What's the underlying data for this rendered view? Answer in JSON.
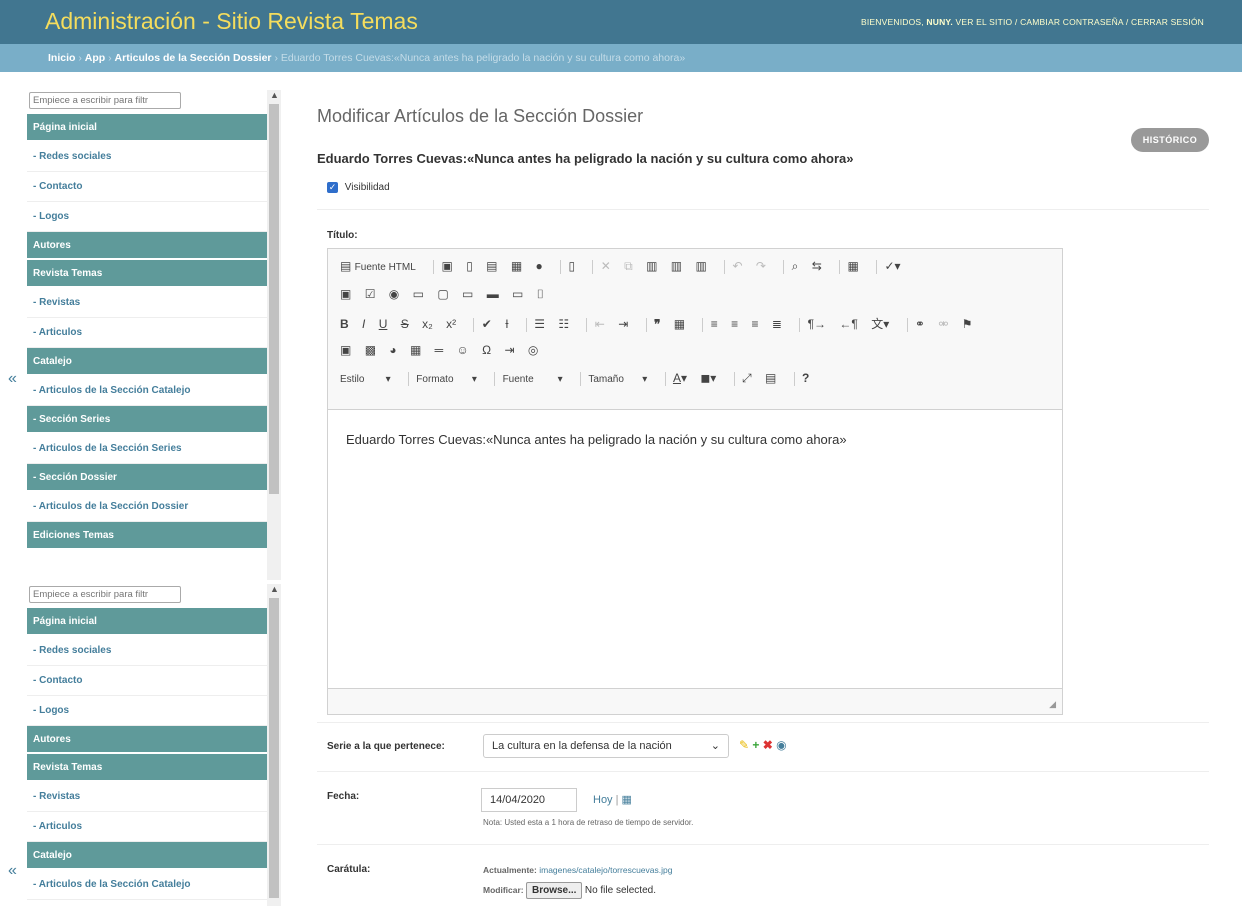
{
  "header": {
    "brand": "Administración - Sitio Revista Temas",
    "welcome": "BIENVENIDOS,",
    "user": "NUNY.",
    "view_site": "VER EL SITIO",
    "change_password": "CAMBIAR CONTRASEÑA",
    "logout": "CERRAR SESIÓN"
  },
  "breadcrumb": {
    "home": "Inicio",
    "app": "App",
    "model": "Articulos de la Sección Dossier",
    "current": "Eduardo Torres Cuevas:«Nunca antes ha peligrado la nación y su cultura como ahora»"
  },
  "sidebar": {
    "filter_placeholder": "Empiece a escribir para filtr",
    "items": [
      {
        "label": "Página inicial",
        "kind": "cap"
      },
      {
        "label": "- Redes sociales",
        "kind": "link"
      },
      {
        "label": "- Contacto",
        "kind": "link"
      },
      {
        "label": "- Logos",
        "kind": "link"
      },
      {
        "label": "Autores",
        "kind": "cap"
      },
      {
        "label": "Revista Temas",
        "kind": "cap"
      },
      {
        "label": "- Revistas",
        "kind": "link"
      },
      {
        "label": "- Articulos",
        "kind": "link"
      },
      {
        "label": "Catalejo",
        "kind": "cap"
      },
      {
        "label": "- Articulos de la Sección Catalejo",
        "kind": "link"
      },
      {
        "label": "- Sección Series",
        "kind": "cap"
      },
      {
        "label": "- Articulos de la Sección Series",
        "kind": "link"
      },
      {
        "label": "- Sección Dossier",
        "kind": "cap"
      },
      {
        "label": "- Articulos de la Sección Dossier",
        "kind": "link"
      },
      {
        "label": "Ediciones Temas",
        "kind": "cap"
      }
    ],
    "collapse_icon": "«"
  },
  "main": {
    "page_title": "Modificar Artículos de la Sección Dossier",
    "history_button": "HISTÓRICO",
    "object_title": "Eduardo Torres Cuevas:«Nunca antes ha peligrado la nación y su cultura como ahora»",
    "visibility_label": "Visibilidad",
    "title_label": "Título:",
    "editor": {
      "source_label": "Fuente HTML",
      "style_combo": "Estilo",
      "format_combo": "Formato",
      "font_combo": "Fuente",
      "size_combo": "Tamaño",
      "content": "Eduardo Torres Cuevas:«Nunca antes ha peligrado la nación y su cultura como ahora»"
    },
    "series_label": "Serie a la que pertenece:",
    "series_value": "La cultura en la defensa de la nación",
    "date_label": "Fecha:",
    "date_value": "14/04/2020",
    "today_link": "Hoy",
    "date_note": "Nota: Usted esta a 1 hora de retraso de tiempo de servidor.",
    "cover_label": "Carátula:",
    "current_label": "Actualmente:",
    "current_file": "imagenes/catalejo/torrescuevas.jpg",
    "modify_label": "Modificar:",
    "browse_button": "Browse...",
    "no_file": "No file selected."
  }
}
